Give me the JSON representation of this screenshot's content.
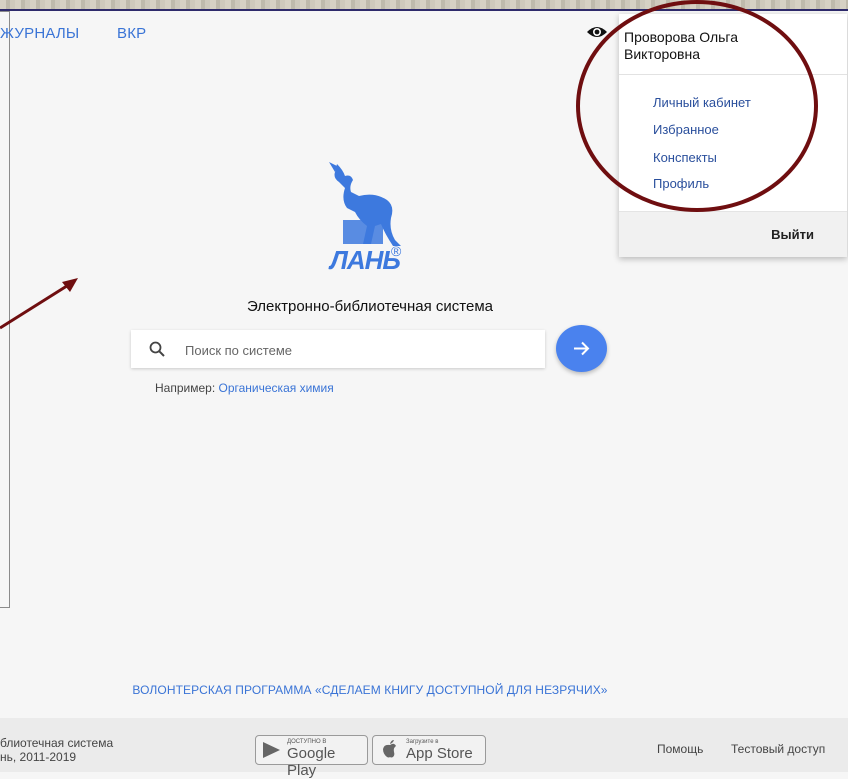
{
  "nav": {
    "journals_label": "ЖУРНАЛЫ",
    "vkr_label": "ВКР"
  },
  "user_menu": {
    "username_line1": "Проворова Ольга",
    "username_line2": "Викторовна",
    "items": [
      {
        "label": "Личный кабинет"
      },
      {
        "label": "Избранное"
      },
      {
        "label": "Конспекты"
      },
      {
        "label": "Профиль"
      }
    ],
    "logout_label": "Выйти"
  },
  "logo": {
    "text": "ЛАНЬ",
    "reg": "®",
    "icon": "deer-logo-icon"
  },
  "main": {
    "tagline": "Электронно-библиотечная система",
    "search_placeholder": "Поиск по системе",
    "example_prefix": "Например:",
    "example_link": "Органическая химия"
  },
  "volunteer_link": "ВОЛОНТЕРСКАЯ ПРОГРАММА «СДЕЛАЕМ КНИГУ ДОСТУПНОЙ ДЛЯ НЕЗРЯЧИХ»",
  "footer": {
    "line1": "блиотечная система",
    "line2": "нь, 2011-2019",
    "google_small": "ДОСТУПНО В",
    "google_big": "Google Play",
    "apple_small": "Загрузите в",
    "apple_big": "App Store",
    "help_label": "Помощь",
    "test_access_label": "Тестовый доступ"
  },
  "colors": {
    "accent": "#3d79de",
    "annotation": "#6f0e10"
  }
}
